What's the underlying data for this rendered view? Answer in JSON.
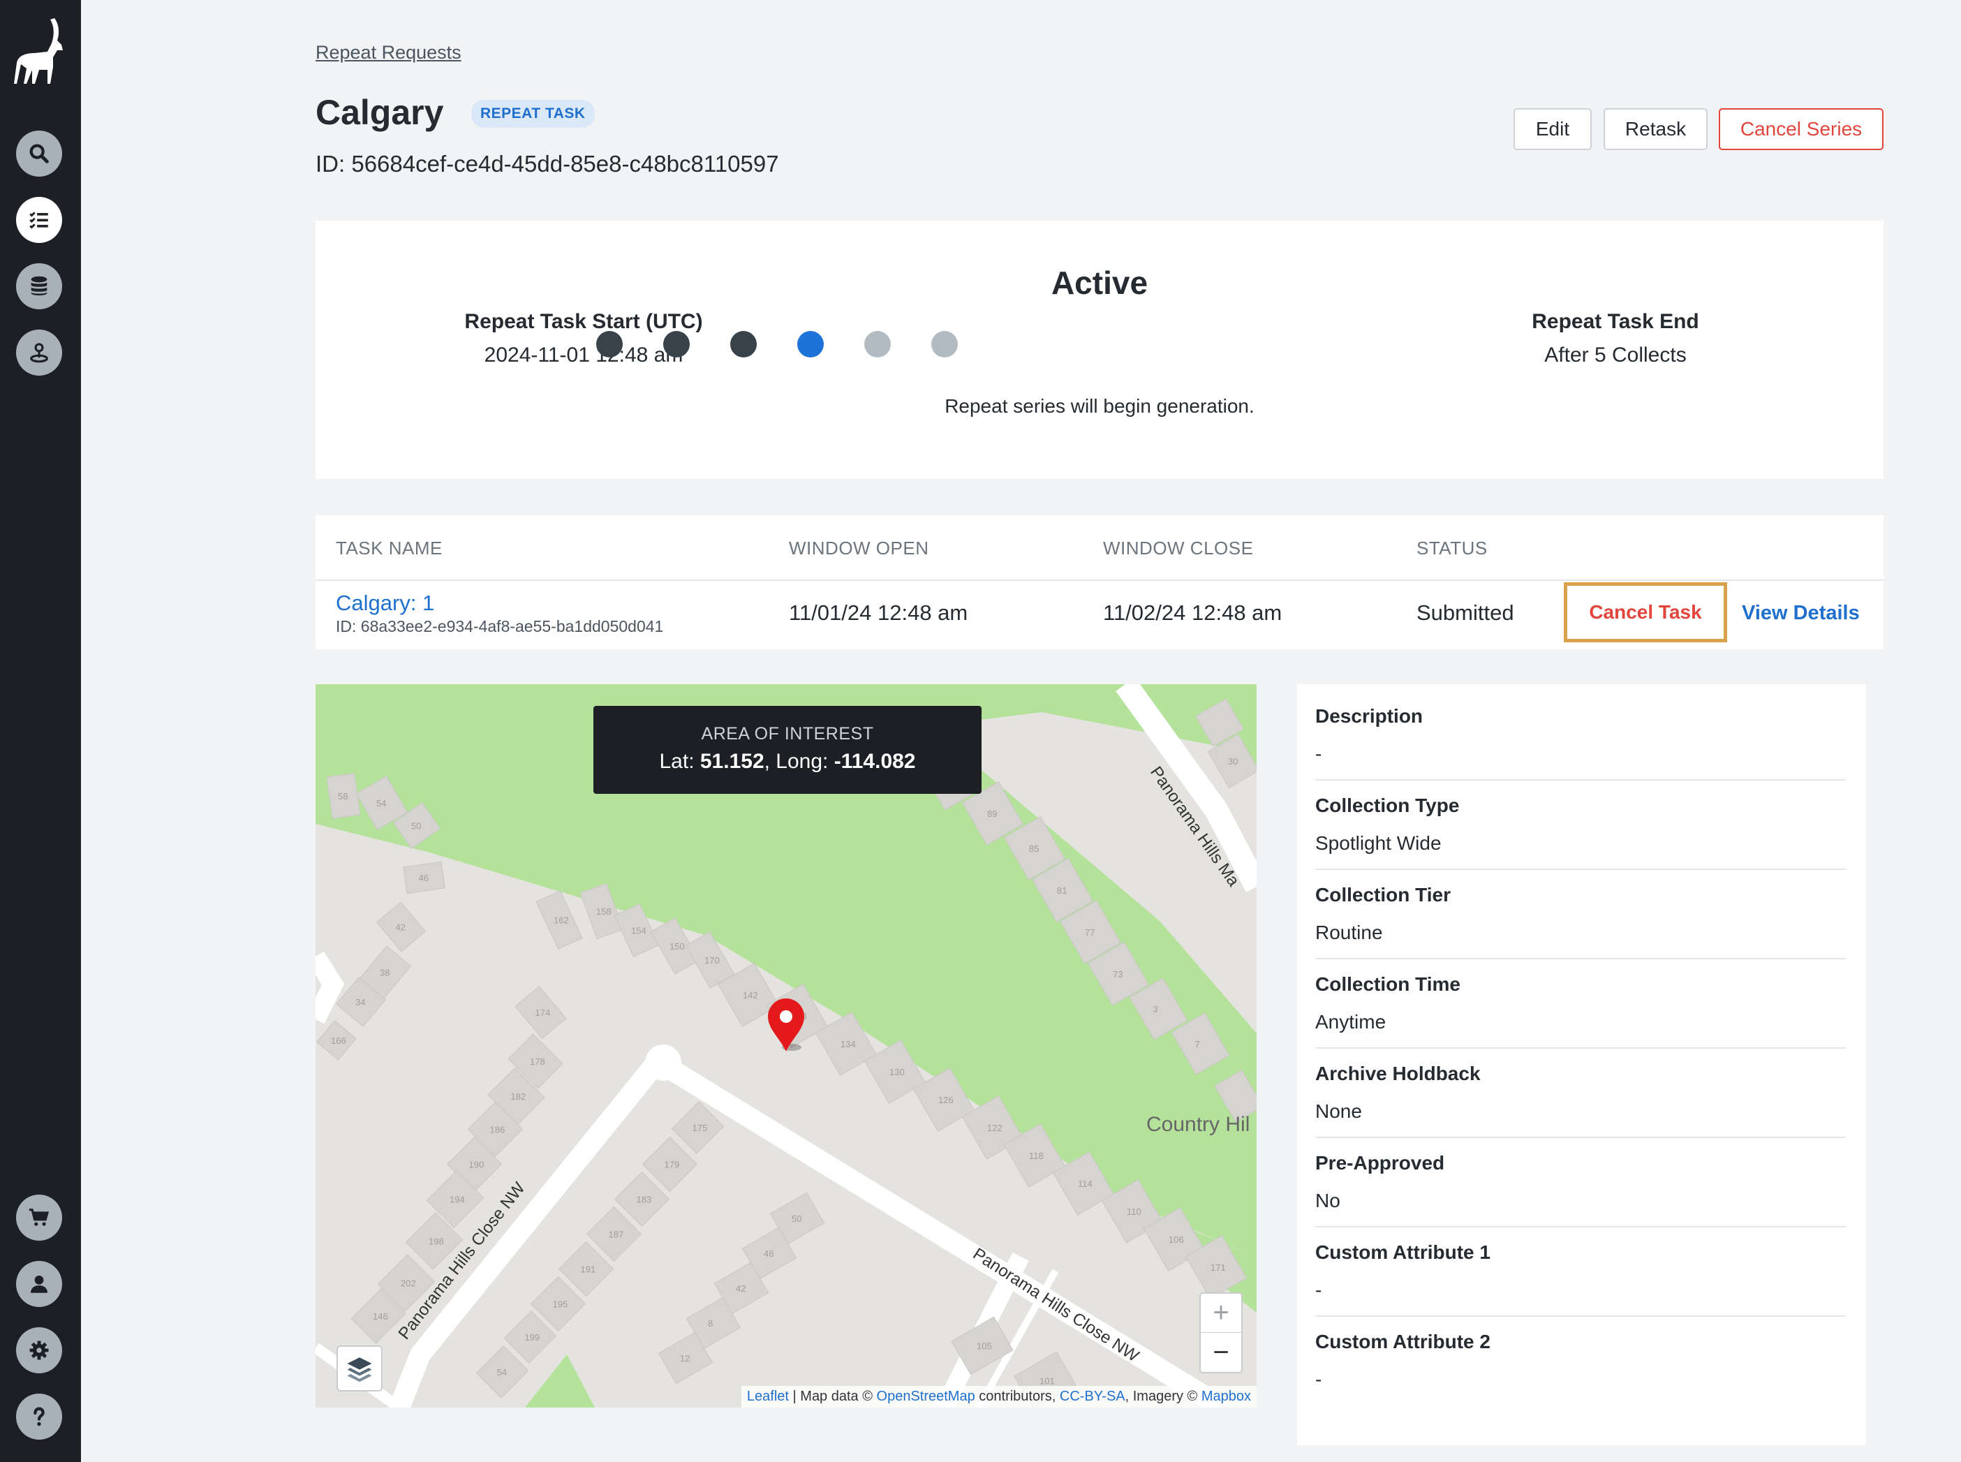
{
  "sidebar": {
    "logo_name": "antelope-logo",
    "top_items": [
      "search-icon",
      "task-list-icon",
      "database-icon",
      "location-icon"
    ],
    "bottom_items": [
      "cart-icon",
      "user-icon",
      "gear-icon",
      "help-icon"
    ]
  },
  "breadcrumb": "Repeat Requests",
  "header": {
    "title": "Calgary",
    "badge": "REPEAT TASK",
    "id_text": "ID: 56684cef-ce4d-45dd-85e8-c48bc8110597",
    "edit_label": "Edit",
    "retask_label": "Retask",
    "cancel_series_label": "Cancel Series"
  },
  "status": {
    "title": "Active",
    "start_label": "Repeat Task Start (UTC)",
    "start_value": "2024-11-01 12:48 am",
    "end_label": "Repeat Task End",
    "end_value": "After 5 Collects",
    "note": "Repeat series will begin generation.",
    "dots": [
      "complete",
      "complete",
      "complete",
      "current",
      "pending",
      "pending"
    ],
    "colors": {
      "complete": "#37424b",
      "current": "#1e73d8",
      "pending": "#b3bbc2"
    }
  },
  "table": {
    "headers": [
      "TASK NAME",
      "WINDOW OPEN",
      "WINDOW CLOSE",
      "STATUS"
    ],
    "row": {
      "name": "Calgary: 1",
      "id": "ID: 68a33ee2-e934-4af8-ae55-ba1dd050d041",
      "window_open": "11/01/24 12:48 am",
      "window_close": "11/02/24 12:48 am",
      "status": "Submitted",
      "cancel_label": "Cancel Task",
      "view_label": "View Details"
    }
  },
  "map": {
    "aoi_label": "AREA OF INTEREST",
    "lat_label": "Lat: ",
    "lat": "51.152",
    "long_label": ", Long: ",
    "long": "-114.082",
    "zoom_in": "+",
    "zoom_out": "−",
    "attribution": {
      "leaflet": "Leaflet",
      "sep1": " | Map data © ",
      "osm": "OpenStreetMap",
      "sep2": " contributors, ",
      "license": "CC-BY-SA",
      "sep3": ", Imagery © ",
      "mapbox": "Mapbox"
    },
    "labels": {
      "road1": "Panorama Hills Close NW",
      "road2": "Panorama Hills Close NW",
      "road3": "Panorama Hills Ma",
      "park": "Country Hil"
    },
    "house_numbers": [
      "58",
      "54",
      "50",
      "46",
      "42",
      "38",
      "34",
      "166",
      "162",
      "158",
      "154",
      "150",
      "170",
      "174",
      "178",
      "182",
      "186",
      "190",
      "194",
      "198",
      "202",
      "146",
      "142",
      "138",
      "134",
      "130",
      "126",
      "122",
      "118",
      "114",
      "110",
      "106",
      "171",
      "175",
      "179",
      "183",
      "187",
      "191",
      "195",
      "199",
      "54",
      "50",
      "46",
      "42",
      "8",
      "12",
      "105",
      "101",
      "97",
      "93",
      "89",
      "85",
      "81",
      "77",
      "73",
      "3",
      "7",
      "30"
    ],
    "colors": {
      "park": "#b5e29a",
      "land": "#e5e3df",
      "building": "#d6d4d1",
      "road": "#ffffff",
      "pin": "#e3191c"
    }
  },
  "details": [
    {
      "label": "Description",
      "value": "-"
    },
    {
      "label": "Collection Type",
      "value": "Spotlight Wide"
    },
    {
      "label": "Collection Tier",
      "value": "Routine"
    },
    {
      "label": "Collection Time",
      "value": "Anytime"
    },
    {
      "label": "Archive Holdback",
      "value": "None"
    },
    {
      "label": "Pre-Approved",
      "value": "No"
    },
    {
      "label": "Custom Attribute 1",
      "value": "-"
    },
    {
      "label": "Custom Attribute 2",
      "value": "-"
    }
  ]
}
